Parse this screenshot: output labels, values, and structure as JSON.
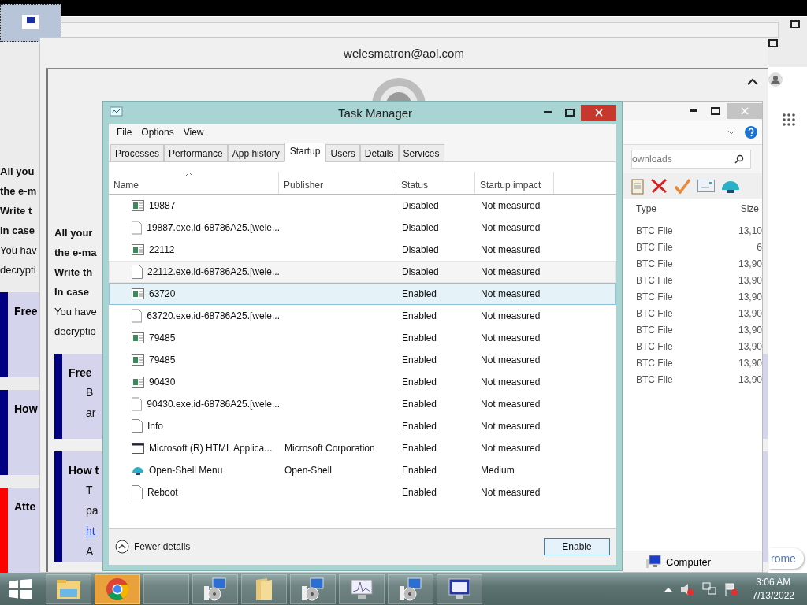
{
  "back_note": {
    "lines": [
      {
        "text": "All you",
        "bold": true
      },
      {
        "text": "the e-m",
        "bold": true
      },
      {
        "text": "Write t",
        "bold": true
      },
      {
        "text": "In case",
        "bold": true
      },
      {
        "text": "You hav",
        "bold": false
      },
      {
        "text": "decrypti",
        "bold": false
      }
    ],
    "boxes": [
      {
        "title": "Free",
        "color": "#000080"
      },
      {
        "title": "How",
        "color": "#000080"
      },
      {
        "title": "Atte",
        "color": "#ff0000"
      }
    ]
  },
  "note_window": {
    "title": "welesmatron@aol.com",
    "lines": [
      {
        "text": "All your",
        "bold": true
      },
      {
        "text": "the e-ma",
        "bold": true
      },
      {
        "text": "Write th",
        "bold": true
      },
      {
        "text": "In case",
        "bold": true
      },
      {
        "text": "You have",
        "bold": false
      },
      {
        "text": "decryptio",
        "bold": false
      }
    ],
    "boxes": [
      {
        "title": "Free",
        "color": "#000080",
        "lines": [
          {
            "text": "B",
            "kind": "text"
          },
          {
            "text": "ar",
            "kind": "text"
          }
        ]
      },
      {
        "title": "How t",
        "color": "#000080",
        "lines": [
          {
            "text": "T",
            "kind": "text"
          },
          {
            "text": "pa",
            "kind": "text"
          },
          {
            "text": "ht",
            "kind": "link"
          },
          {
            "text": "A",
            "kind": "text"
          }
        ]
      }
    ]
  },
  "browser": {
    "tab_text": "rome"
  },
  "explorer": {
    "search": {
      "placeholder": "ownloads"
    },
    "columns": [
      "Type",
      "Size"
    ],
    "rows": [
      {
        "type": "BTC File",
        "size": "13,10"
      },
      {
        "type": "BTC File",
        "size": "6"
      },
      {
        "type": "BTC File",
        "size": "13,90"
      },
      {
        "type": "BTC File",
        "size": "13,90"
      },
      {
        "type": "BTC File",
        "size": "13,90"
      },
      {
        "type": "BTC File",
        "size": "13,90"
      },
      {
        "type": "BTC File",
        "size": "13,90"
      },
      {
        "type": "BTC File",
        "size": "13,90"
      },
      {
        "type": "BTC File",
        "size": "13,90"
      },
      {
        "type": "BTC File",
        "size": "13,90"
      }
    ],
    "status_bar": "Computer"
  },
  "task_manager": {
    "title": "Task Manager",
    "menu": [
      "File",
      "Options",
      "View"
    ],
    "tabs": [
      {
        "label": "Processes",
        "selected": false
      },
      {
        "label": "Performance",
        "selected": false
      },
      {
        "label": "App history",
        "selected": false
      },
      {
        "label": "Startup",
        "selected": true
      },
      {
        "label": "Users",
        "selected": false
      },
      {
        "label": "Details",
        "selected": false
      },
      {
        "label": "Services",
        "selected": false
      }
    ],
    "columns": [
      "Name",
      "Publisher",
      "Status",
      "Startup impact"
    ],
    "rows": [
      {
        "kind": "app",
        "name": "19887",
        "publisher": "",
        "status": "Disabled",
        "impact": "Not measured",
        "selected": false,
        "hovered": false
      },
      {
        "kind": "file",
        "name": "19887.exe.id-68786A25.[wele...",
        "publisher": "",
        "status": "Disabled",
        "impact": "Not measured",
        "selected": false,
        "hovered": false
      },
      {
        "kind": "app",
        "name": "22112",
        "publisher": "",
        "status": "Disabled",
        "impact": "Not measured",
        "selected": false,
        "hovered": false
      },
      {
        "kind": "file",
        "name": "22112.exe.id-68786A25.[wele...",
        "publisher": "",
        "status": "Disabled",
        "impact": "Not measured",
        "selected": false,
        "hovered": true
      },
      {
        "kind": "app",
        "name": "63720",
        "publisher": "",
        "status": "Enabled",
        "impact": "Not measured",
        "selected": true,
        "hovered": false
      },
      {
        "kind": "file",
        "name": "63720.exe.id-68786A25.[wele...",
        "publisher": "",
        "status": "Enabled",
        "impact": "Not measured",
        "selected": false,
        "hovered": false
      },
      {
        "kind": "app",
        "name": "79485",
        "publisher": "",
        "status": "Enabled",
        "impact": "Not measured",
        "selected": false,
        "hovered": false
      },
      {
        "kind": "app",
        "name": "79485",
        "publisher": "",
        "status": "Enabled",
        "impact": "Not measured",
        "selected": false,
        "hovered": false
      },
      {
        "kind": "app",
        "name": "90430",
        "publisher": "",
        "status": "Enabled",
        "impact": "Not measured",
        "selected": false,
        "hovered": false
      },
      {
        "kind": "file",
        "name": "90430.exe.id-68786A25.[wele...",
        "publisher": "",
        "status": "Enabled",
        "impact": "Not measured",
        "selected": false,
        "hovered": false
      },
      {
        "kind": "file",
        "name": "Info",
        "publisher": "",
        "status": "Enabled",
        "impact": "Not measured",
        "selected": false,
        "hovered": false
      },
      {
        "kind": "window",
        "name": "Microsoft (R) HTML Applica...",
        "publisher": "Microsoft Corporation",
        "status": "Enabled",
        "impact": "Not measured",
        "selected": false,
        "hovered": false
      },
      {
        "kind": "shell",
        "name": "Open-Shell Menu",
        "publisher": "Open-Shell",
        "status": "Enabled",
        "impact": "Medium",
        "selected": false,
        "hovered": false
      },
      {
        "kind": "file",
        "name": "Reboot",
        "publisher": "",
        "status": "Enabled",
        "impact": "Not measured",
        "selected": false,
        "hovered": false
      }
    ],
    "fewer_details": "Fewer details",
    "enable_button": "Enable"
  },
  "taskbar": {
    "items": [
      {
        "kind": "explorer",
        "selected": false
      },
      {
        "kind": "chrome",
        "selected": true
      },
      {
        "kind": "blank",
        "selected": false
      },
      {
        "kind": "installer",
        "selected": false
      },
      {
        "kind": "folder",
        "selected": false
      },
      {
        "kind": "installer",
        "selected": false
      },
      {
        "kind": "monitor",
        "selected": false
      },
      {
        "kind": "installer",
        "selected": false
      },
      {
        "kind": "screen",
        "selected": false
      }
    ],
    "time": "3:06 AM",
    "date": "7/13/2022"
  }
}
